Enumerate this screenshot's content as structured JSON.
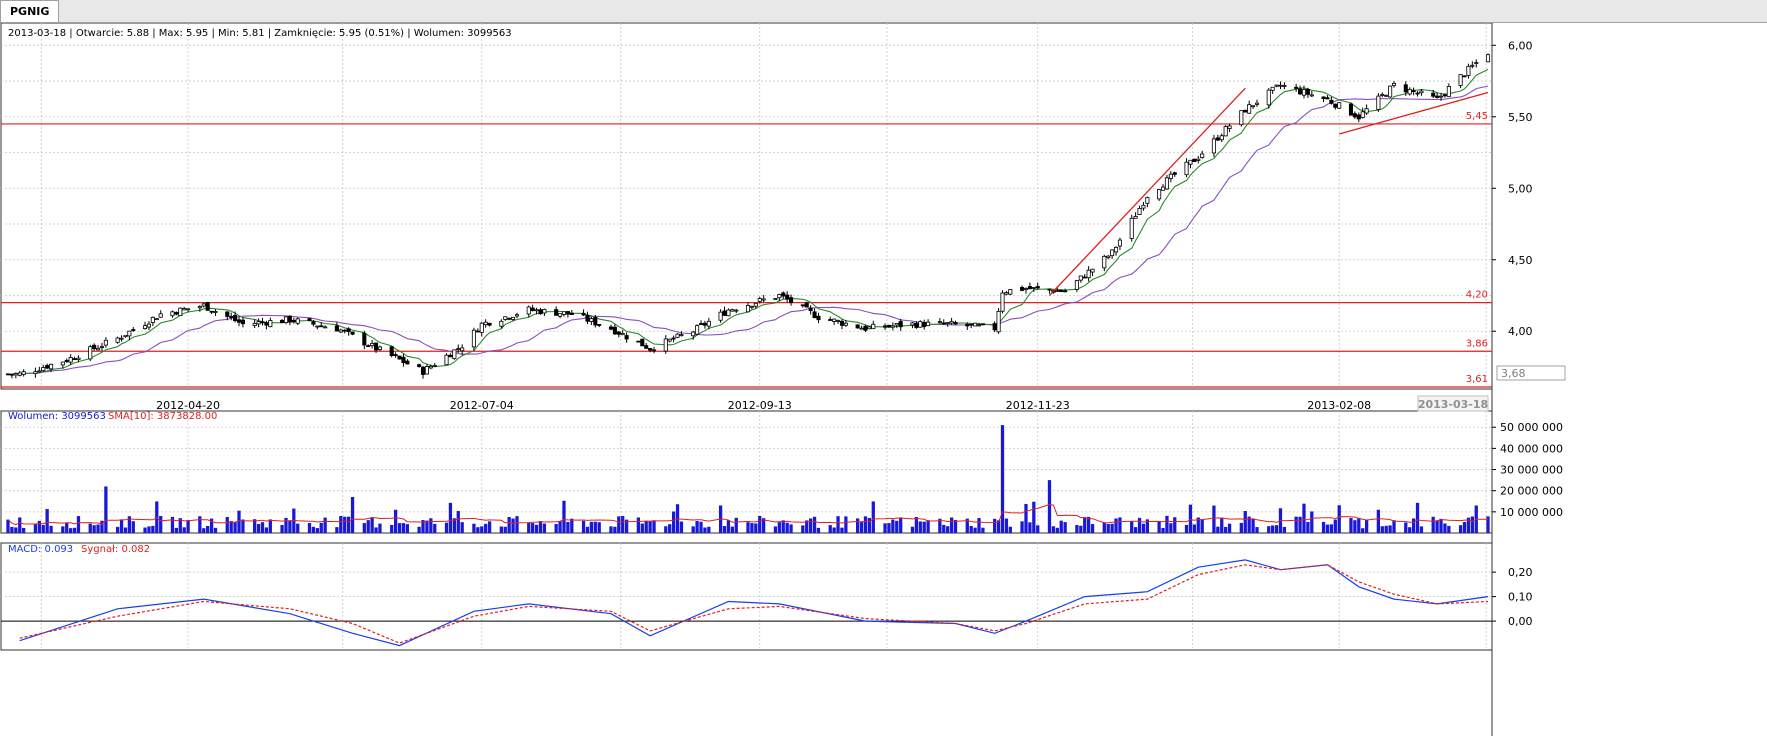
{
  "tab": {
    "label": "PGNIG"
  },
  "info_line": "2013-03-18 | Otwarcie: 5.88 | Max: 5.95 | Min: 5.81 | Zamknięcie: 5.95 (0.51%) | Wolumen: 3099563",
  "colors": {
    "bull_candle": "#ffffff",
    "bear_candle": "#000000",
    "sma_short": "#2a8a2a",
    "sma_long": "#8a4fc0",
    "horizontal_line": "#e02020",
    "trend_line": "#e02020",
    "volume_bar": "#1818d8",
    "volume_sma": "#e02020",
    "macd": "#1a3ee8",
    "signal": "#e02020",
    "grid": "#c8c8c8"
  },
  "chart_data": [
    {
      "type": "candlestick",
      "panel": "price",
      "title": "",
      "x_ticks": [
        "2012-04-20",
        "2012-07-04",
        "2012-09-13",
        "2012-11-23",
        "2013-02-08"
      ],
      "x_current_label": "2013-03-18",
      "y_ticks": [
        "4,00",
        "4,50",
        "5,00",
        "5,50",
        "6,00"
      ],
      "ylim": [
        3.61,
        6.1
      ],
      "y_current_label": "3,68",
      "horizontal_lines": [
        {
          "value": 5.45,
          "label": "5,45"
        },
        {
          "value": 4.2,
          "label": "4,20"
        },
        {
          "value": 3.86,
          "label": "3,86"
        },
        {
          "value": 3.61,
          "label": "3,61"
        }
      ],
      "trend_lines": [
        {
          "from": {
            "date": "2012-11-26",
            "value": 4.25
          },
          "to": {
            "date": "2013-01-15",
            "value": 5.7
          }
        },
        {
          "from": {
            "date": "2013-02-08",
            "value": 5.38
          },
          "to": {
            "date": "2013-03-18",
            "value": 5.67
          }
        }
      ],
      "close_path_keys": {
        "dates": [
          "2012-03-08",
          "2012-03-20",
          "2012-04-02",
          "2012-04-13",
          "2012-04-24",
          "2012-05-04",
          "2012-05-16",
          "2012-05-28",
          "2012-06-07",
          "2012-06-19",
          "2012-06-29",
          "2012-07-04",
          "2012-07-16",
          "2012-07-27",
          "2012-08-06",
          "2012-08-16",
          "2012-08-27",
          "2012-09-05",
          "2012-09-18",
          "2012-09-28",
          "2012-10-10",
          "2012-10-22",
          "2012-10-31",
          "2012-11-12",
          "2012-11-14",
          "2012-11-20",
          "2012-11-30",
          "2012-12-12",
          "2012-12-21",
          "2013-01-03",
          "2013-01-15",
          "2013-01-24",
          "2013-02-05",
          "2013-02-13",
          "2013-02-22",
          "2013-03-05",
          "2013-03-11",
          "2013-03-18"
        ],
        "close": [
          3.7,
          3.8,
          3.95,
          4.12,
          4.18,
          4.05,
          4.08,
          4.02,
          3.88,
          3.72,
          3.9,
          4.05,
          4.15,
          4.12,
          4.02,
          3.88,
          4.0,
          4.15,
          4.25,
          4.1,
          4.02,
          4.05,
          4.05,
          4.02,
          4.28,
          4.3,
          4.28,
          4.55,
          4.95,
          5.22,
          5.55,
          5.72,
          5.62,
          5.5,
          5.72,
          5.62,
          5.78,
          5.95
        ]
      },
      "series": [
        {
          "name": "",
          "type": "sma-short"
        },
        {
          "name": "",
          "type": "sma-long"
        }
      ]
    },
    {
      "type": "bar",
      "panel": "volume",
      "title": "",
      "legend": {
        "volume_label": "Wolumen: 3099563",
        "sma_label": "SMA[10]: 3873828.00"
      },
      "y_ticks": [
        "10 000 000",
        "20 000 000",
        "30 000 000",
        "40 000 000",
        "50 000 000"
      ],
      "ylim": [
        0,
        52000000
      ],
      "spikes": [
        {
          "date": "2012-03-30",
          "value": 22000000
        },
        {
          "date": "2012-06-01",
          "value": 17000000
        },
        {
          "date": "2012-11-14",
          "value": 51000000
        },
        {
          "date": "2012-11-26",
          "value": 25000000
        }
      ],
      "baseline": 4500000
    },
    {
      "type": "line",
      "panel": "macd",
      "title": "",
      "legend": {
        "macd_label": "MACD: 0.093",
        "signal_label": "Sygnał: 0.082"
      },
      "y_ticks": [
        "0,00",
        "0,10",
        "0,20"
      ],
      "ylim": [
        -0.11,
        0.27
      ],
      "series": [
        {
          "name": "MACD",
          "dates": [
            "2012-03-08",
            "2012-04-02",
            "2012-04-24",
            "2012-05-16",
            "2012-06-01",
            "2012-06-13",
            "2012-07-02",
            "2012-07-16",
            "2012-08-06",
            "2012-08-16",
            "2012-09-05",
            "2012-09-18",
            "2012-10-10",
            "2012-11-02",
            "2012-11-12",
            "2012-11-20",
            "2012-12-05",
            "2012-12-21",
            "2013-01-03",
            "2013-01-15",
            "2013-01-24",
            "2013-02-05",
            "2013-02-13",
            "2013-02-22",
            "2013-03-05",
            "2013-03-18"
          ],
          "values": [
            -0.08,
            0.05,
            0.09,
            0.03,
            -0.05,
            -0.1,
            0.04,
            0.07,
            0.03,
            -0.06,
            0.08,
            0.07,
            0.0,
            -0.01,
            -0.05,
            0.0,
            0.1,
            0.12,
            0.22,
            0.25,
            0.21,
            0.23,
            0.14,
            0.09,
            0.07,
            0.1
          ]
        },
        {
          "name": "Sygnał",
          "dates": [
            "2012-03-08",
            "2012-04-02",
            "2012-04-24",
            "2012-05-16",
            "2012-06-01",
            "2012-06-13",
            "2012-07-02",
            "2012-07-16",
            "2012-08-06",
            "2012-08-16",
            "2012-09-05",
            "2012-09-18",
            "2012-10-10",
            "2012-11-02",
            "2012-11-12",
            "2012-11-20",
            "2012-12-05",
            "2012-12-21",
            "2013-01-03",
            "2013-01-15",
            "2013-01-24",
            "2013-02-05",
            "2013-02-13",
            "2013-02-22",
            "2013-03-05",
            "2013-03-18"
          ],
          "values": [
            -0.07,
            0.02,
            0.08,
            0.05,
            -0.01,
            -0.09,
            0.02,
            0.06,
            0.04,
            -0.04,
            0.05,
            0.06,
            0.01,
            -0.01,
            -0.04,
            -0.01,
            0.07,
            0.09,
            0.19,
            0.23,
            0.21,
            0.23,
            0.16,
            0.11,
            0.07,
            0.08
          ]
        }
      ],
      "zero_line": 0.0
    }
  ]
}
